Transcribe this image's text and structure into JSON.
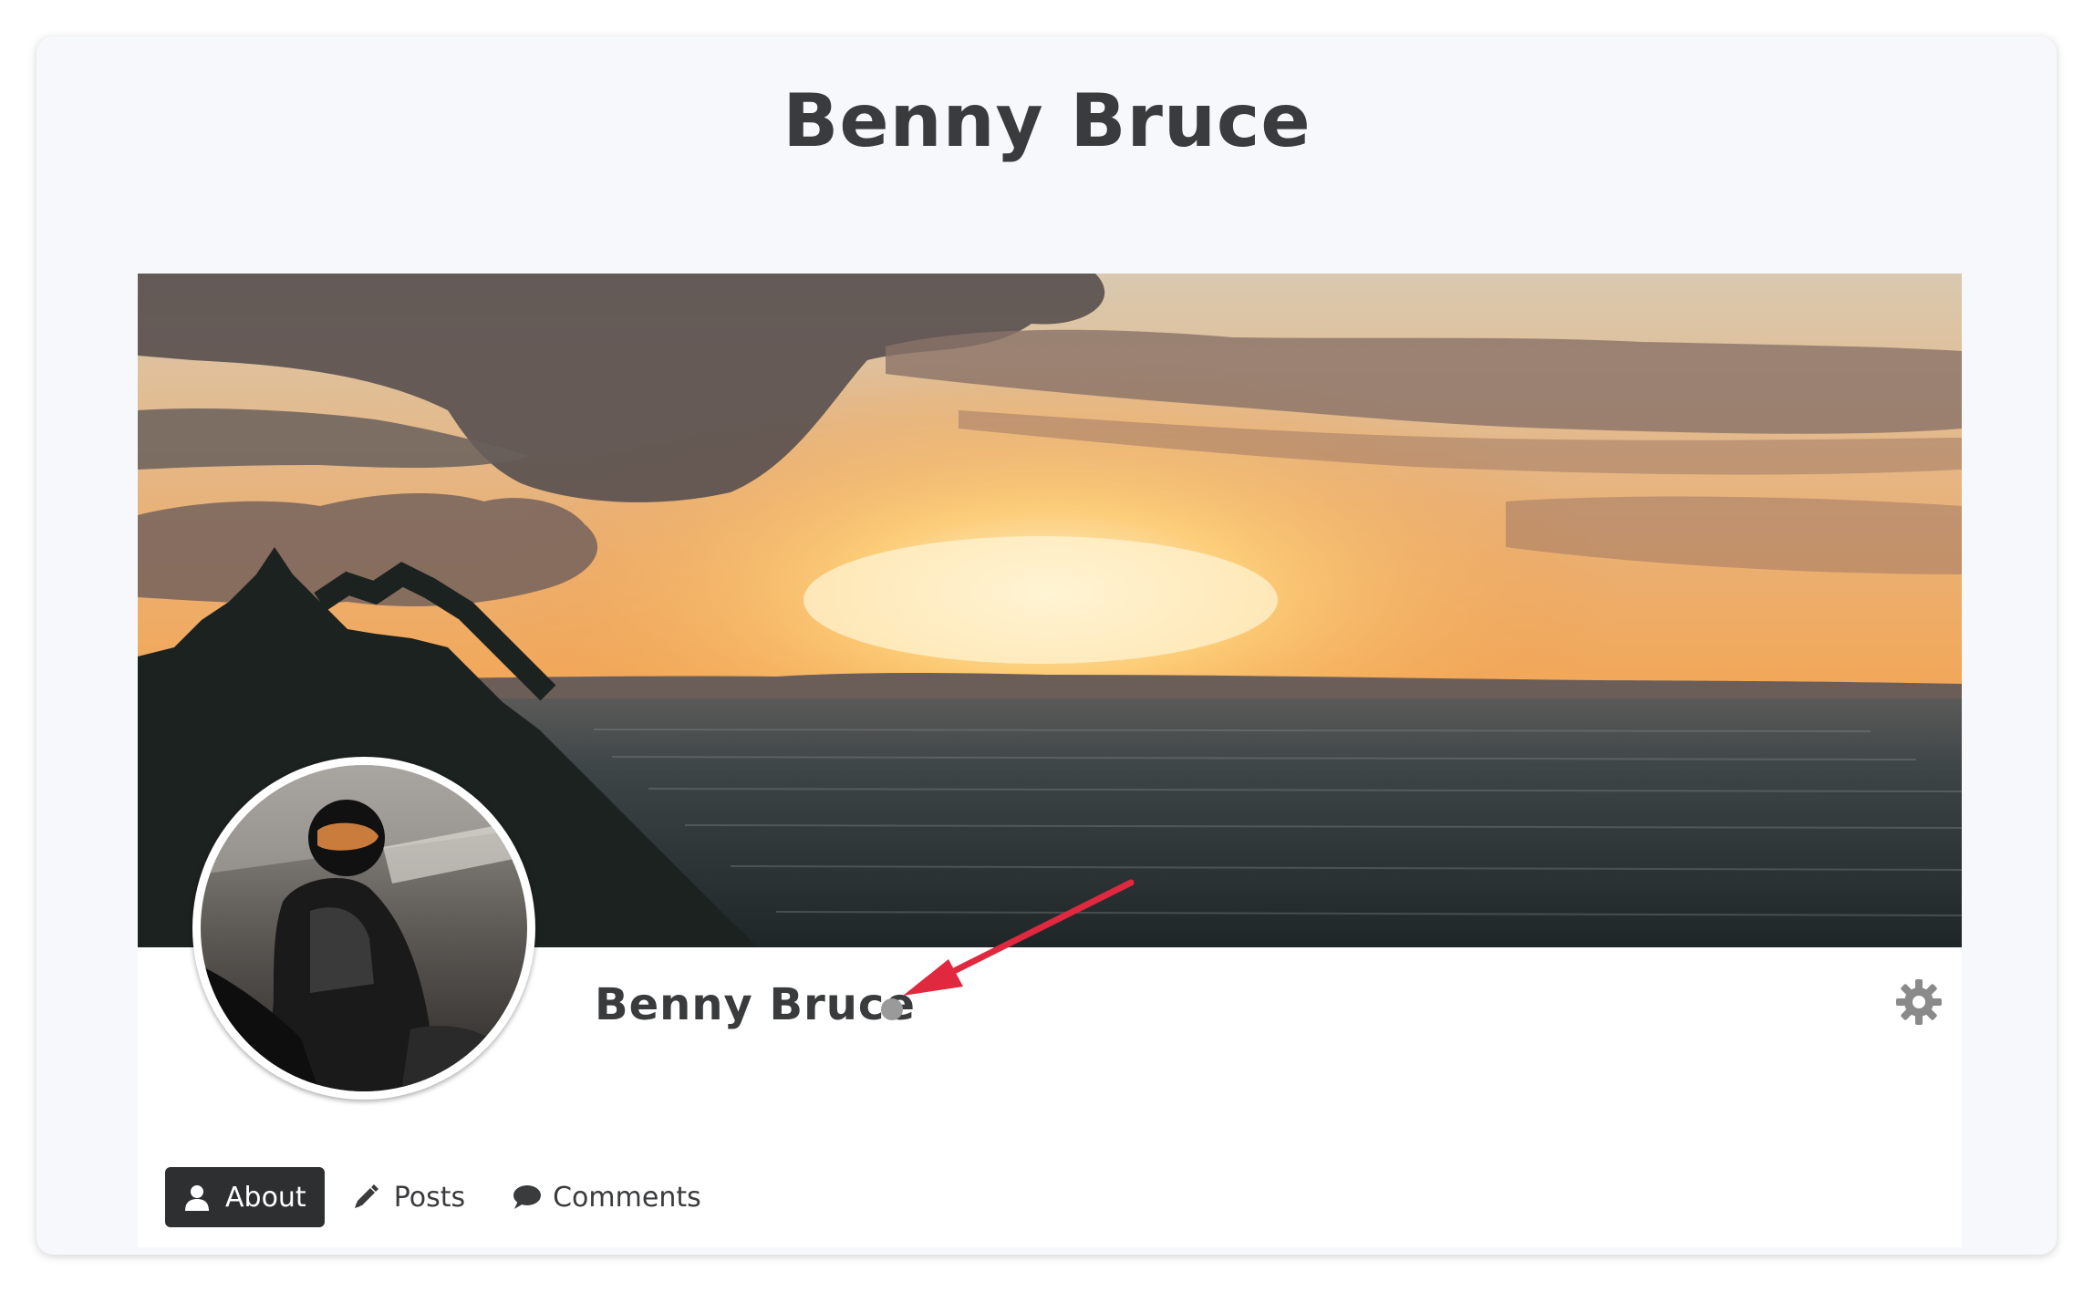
{
  "page": {
    "title": "Benny Bruce"
  },
  "profile": {
    "name": "Benny Bruce",
    "status_color": "#9a9a9a",
    "cover_image": "sunset-over-sea-photo",
    "avatar_image": "motorcyclist-in-helmet-photo"
  },
  "tabs": [
    {
      "label": "About",
      "icon": "user-icon",
      "active": true
    },
    {
      "label": "Posts",
      "icon": "pencil-icon",
      "active": false
    },
    {
      "label": "Comments",
      "icon": "speech-bubble-icon",
      "active": false
    }
  ],
  "settings": {
    "icon": "gear-icon"
  },
  "annotation": {
    "arrow_color": "#e0283e"
  }
}
